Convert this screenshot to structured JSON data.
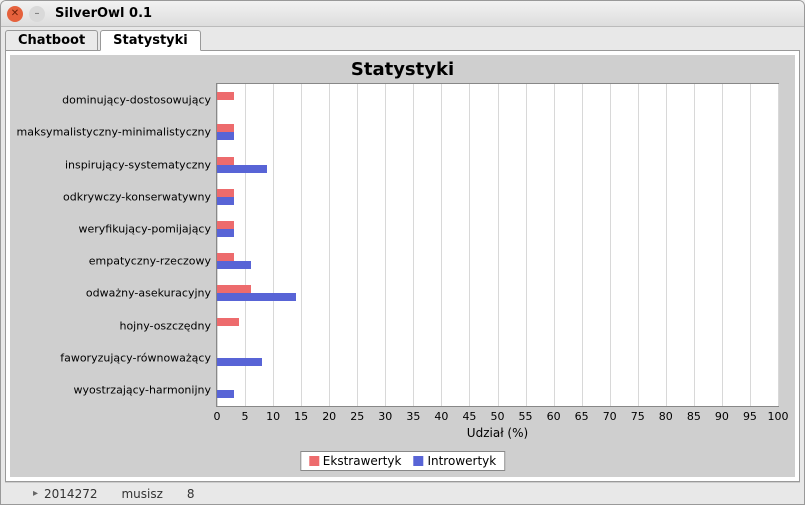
{
  "window": {
    "title": "SilverOwl 0.1"
  },
  "tabs": [
    {
      "label": "Chatboot",
      "active": false
    },
    {
      "label": "Statystyki",
      "active": true
    }
  ],
  "chart_data": {
    "type": "bar",
    "orientation": "horizontal",
    "title": "Statystyki",
    "xlabel": "Udział (%)",
    "ylabel": "",
    "xlim": [
      0,
      100
    ],
    "xticks": [
      0,
      5,
      10,
      15,
      20,
      25,
      30,
      35,
      40,
      45,
      50,
      55,
      60,
      65,
      70,
      75,
      80,
      85,
      90,
      95,
      100
    ],
    "categories": [
      "dominujący-dostosowujący",
      "maksymalistyczny-minimalistyczny",
      "inspirujący-systematyczny",
      "odkrywczy-konserwatywny",
      "weryfikujący-pomijający",
      "empatyczny-rzeczowy",
      "odważny-asekuracyjny",
      "hojny-oszczędny",
      "faworyzujący-równoważący",
      "wyostrzający-harmonijny"
    ],
    "series": [
      {
        "name": "Ekstrawertyk",
        "color": "#ed6b6d",
        "values": [
          3,
          3,
          3,
          3,
          3,
          3,
          6,
          4,
          0,
          0
        ]
      },
      {
        "name": "Introwertyk",
        "color": "#5864d6",
        "values": [
          0,
          3,
          9,
          3,
          3,
          6,
          14,
          0,
          8,
          3
        ]
      }
    ],
    "legend_position": "bottom"
  },
  "legend": {
    "ek": "Ekstrawertyk",
    "in": "Introwertyk"
  },
  "footer": {
    "a": "2014272",
    "b": "musisz",
    "c": "8"
  }
}
